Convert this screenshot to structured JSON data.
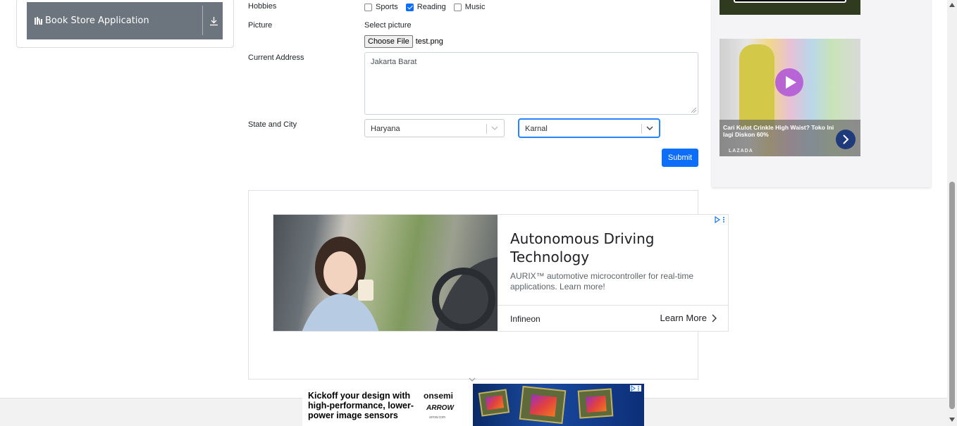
{
  "sidebar": {
    "group_label": "Book Store Application"
  },
  "form": {
    "hobbies": {
      "label": "Hobbies",
      "options": [
        {
          "label": "Sports",
          "checked": false
        },
        {
          "label": "Reading",
          "checked": true
        },
        {
          "label": "Music",
          "checked": false
        }
      ]
    },
    "picture": {
      "label": "Picture",
      "hint": "Select picture",
      "button_label": "Choose File",
      "file_name": "test.png"
    },
    "address": {
      "label": "Current Address",
      "value": "Jakarta Barat"
    },
    "state_city": {
      "label": "State and City",
      "state_value": "Haryana",
      "city_value": "Karnal"
    },
    "submit_label": "Submit"
  },
  "ad_main": {
    "title": "Autonomous Driving Technology",
    "description": "AURIX™ automotive microcontroller for real-time applications. Learn more!",
    "advertiser": "Infineon",
    "cta": "Learn More"
  },
  "ad_side": {
    "caption": "Cari Kulot Crinkle High Waist? Toko Ini lagi Diskon 60%",
    "source": "LAZADA"
  },
  "ad_bottom": {
    "headline": "Kickoff your design with high-performance, lower-power image sensors",
    "logo_primary": "onsemi",
    "logo_secondary": "ARROW",
    "logo_tertiary": "arrow.com"
  },
  "colors": {
    "primary": "#0d6efd",
    "sidebar_group_bg": "#6c757d",
    "focus_border": "#2684ff"
  }
}
